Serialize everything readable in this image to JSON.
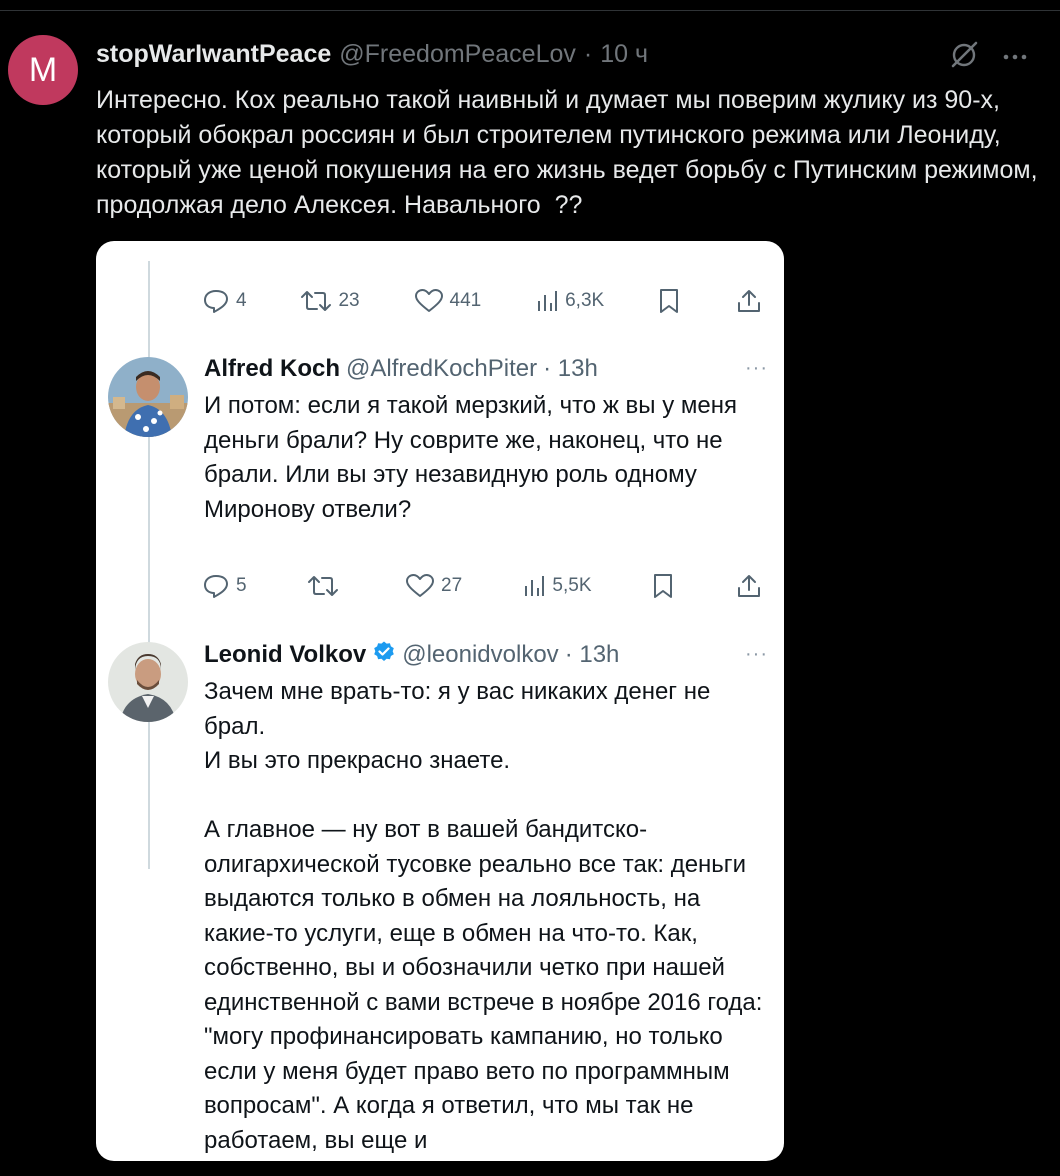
{
  "post": {
    "avatar_letter": "M",
    "avatar_color": "#c0395e",
    "author_name": "stopWarIwantPeace",
    "author_handle": "@FreedomPeaceLov",
    "separator": "·",
    "time": "10 ч",
    "icons": [
      "grok-slash-icon",
      "more-icon"
    ],
    "text": "Интересно. Кох реально такой наивный и думает мы поверим жулику из 90-х, который обокрал россиян и был строителем путинского режима или Леониду, который уже ценой покушения на его жизнь ведет борьбу с Путинским режимом, продолжая дело Алексея. Навального  ??"
  },
  "screenshot": {
    "top_actions": {
      "replies": "4",
      "retweets": "23",
      "likes": "441",
      "views": "6,3K"
    },
    "tweet1": {
      "name": "Alfred Koch",
      "handle": "@AlfredKochPiter",
      "time": "· 13h",
      "more": "···",
      "text": "И потом: если я такой мерзкий, что ж вы у меня деньги брали? Ну соврите же, наконец, что не брали. Или вы эту незавидную роль одному Миронову отвели?",
      "actions": {
        "replies": "5",
        "retweets": "",
        "likes": "27",
        "views": "5,5K"
      }
    },
    "tweet2": {
      "name": "Leonid Volkov",
      "verified": true,
      "handle": "@leonidvolkov",
      "time": "· 13h",
      "more": "···",
      "text": "Зачем мне врать-то: я у вас никаких денег не брал.\nИ вы это прекрасно знаете.\n\nА главное — ну вот в вашей бандитско-олигархической тусовке реально все так: деньги выдаются только в обмен на лояльность, на какие-то услуги, еще в обмен на что-то. Как, собственно, вы и обозначили четко при нашей единственной с вами встрече в ноябре 2016 года: \"могу профинансировать кампанию, но только если у меня будет право вето по программным вопросам\". А когда я ответил, что мы так не работаем, вы еще и"
    }
  },
  "colors": {
    "background": "#000000",
    "card": "#ffffff",
    "text_dark": "#0f1419",
    "text_muted": "#536471",
    "verified_blue": "#1d9bf0"
  }
}
